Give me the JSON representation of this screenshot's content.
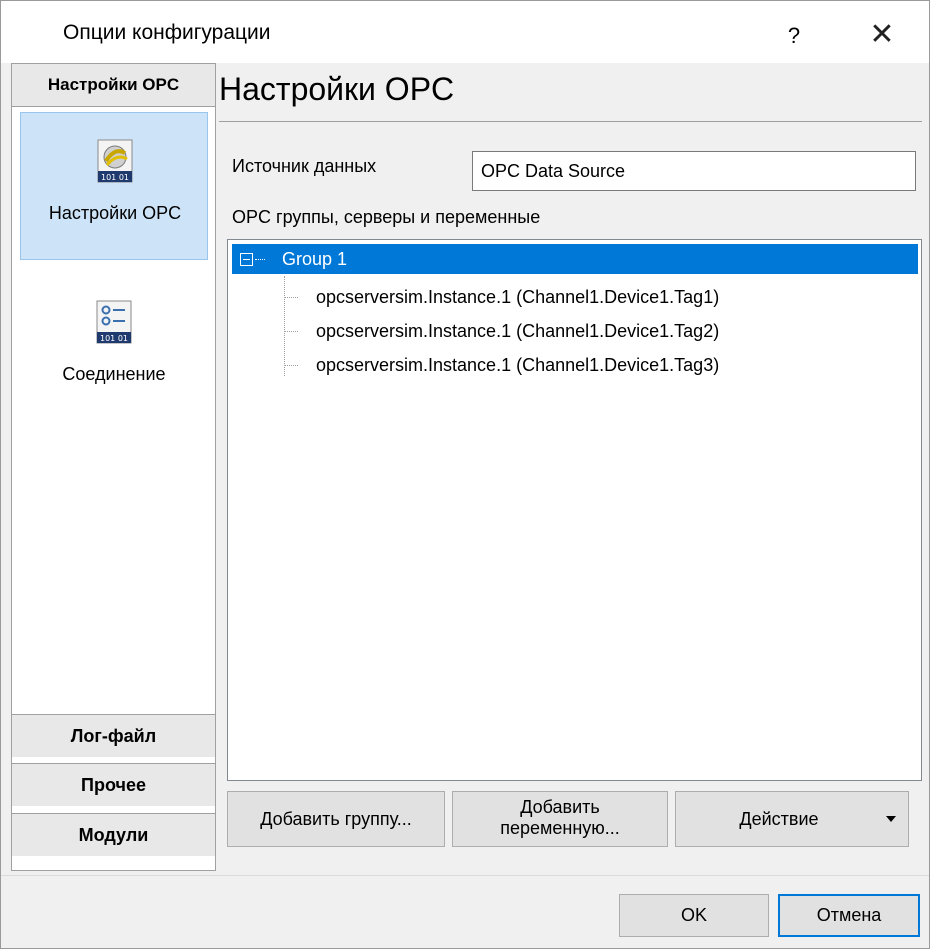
{
  "window": {
    "title": "Опции конфигурации",
    "help_label": "?",
    "close_label": "✕"
  },
  "sidebar": {
    "header": "Настройки OPC",
    "items": [
      {
        "label": "Настройки OPC",
        "icon": "opc-settings-icon",
        "selected": true
      },
      {
        "label": "Соединение",
        "icon": "connection-icon",
        "selected": false
      }
    ],
    "sections": [
      {
        "label": "Лог-файл"
      },
      {
        "label": "Прочее"
      },
      {
        "label": "Модули"
      }
    ]
  },
  "main": {
    "title": "Настройки OPC",
    "source_label": "Источник данных",
    "source_value": "OPC Data Source",
    "tree_label": "OPC группы, серверы и переменные",
    "tree": {
      "group": "Group 1",
      "items": [
        "opcserversim.Instance.1 (Channel1.Device1.Tag1)",
        "opcserversim.Instance.1 (Channel1.Device1.Tag2)",
        "opcserversim.Instance.1 (Channel1.Device1.Tag3)"
      ]
    },
    "buttons": {
      "add_group": "Добавить группу...",
      "add_variable_line1": "Добавить",
      "add_variable_line2": "переменную...",
      "action": "Действие"
    }
  },
  "footer": {
    "ok": "OK",
    "cancel": "Отмена"
  },
  "colors": {
    "selection": "#0078d7",
    "sidebar_selected": "#cde3f7"
  }
}
